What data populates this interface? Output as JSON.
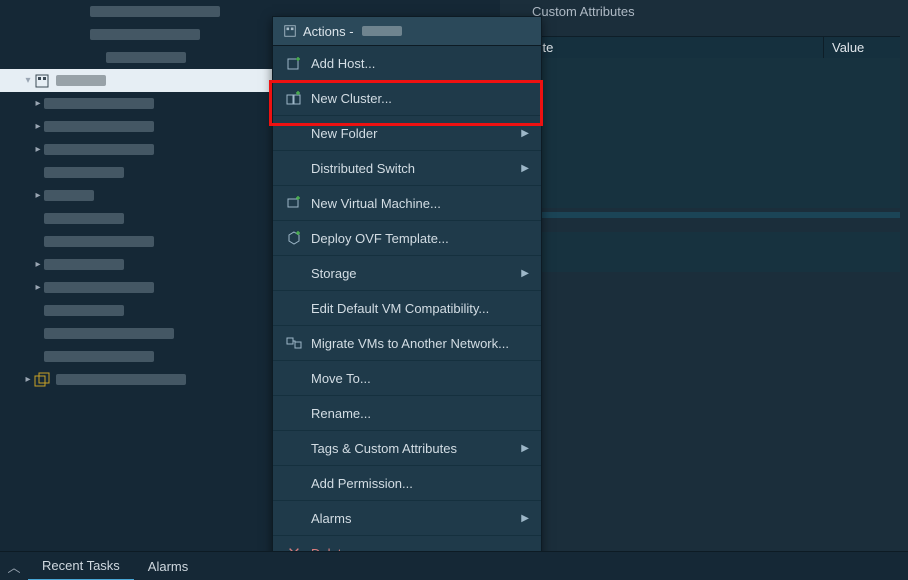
{
  "tree": {
    "selected_label": "█████",
    "vm_container_label": "██████████"
  },
  "detail": {
    "custom_attributes_title": "Custom Attributes",
    "col_attribute": "bute",
    "col_value": "Value"
  },
  "menu": {
    "title": "Actions -",
    "add_host": "Add Host...",
    "new_cluster": "New Cluster...",
    "new_folder": "New Folder",
    "dist_switch": "Distributed Switch",
    "new_vm": "New Virtual Machine...",
    "deploy_ovf": "Deploy OVF Template...",
    "storage": "Storage",
    "edit_compat": "Edit Default VM Compatibility...",
    "migrate": "Migrate VMs to Another Network...",
    "move_to": "Move To...",
    "rename": "Rename...",
    "tags": "Tags & Custom Attributes",
    "add_perm": "Add Permission...",
    "alarms": "Alarms",
    "delete": "Delete"
  },
  "bottom": {
    "recent_tasks": "Recent Tasks",
    "alarms": "Alarms"
  }
}
